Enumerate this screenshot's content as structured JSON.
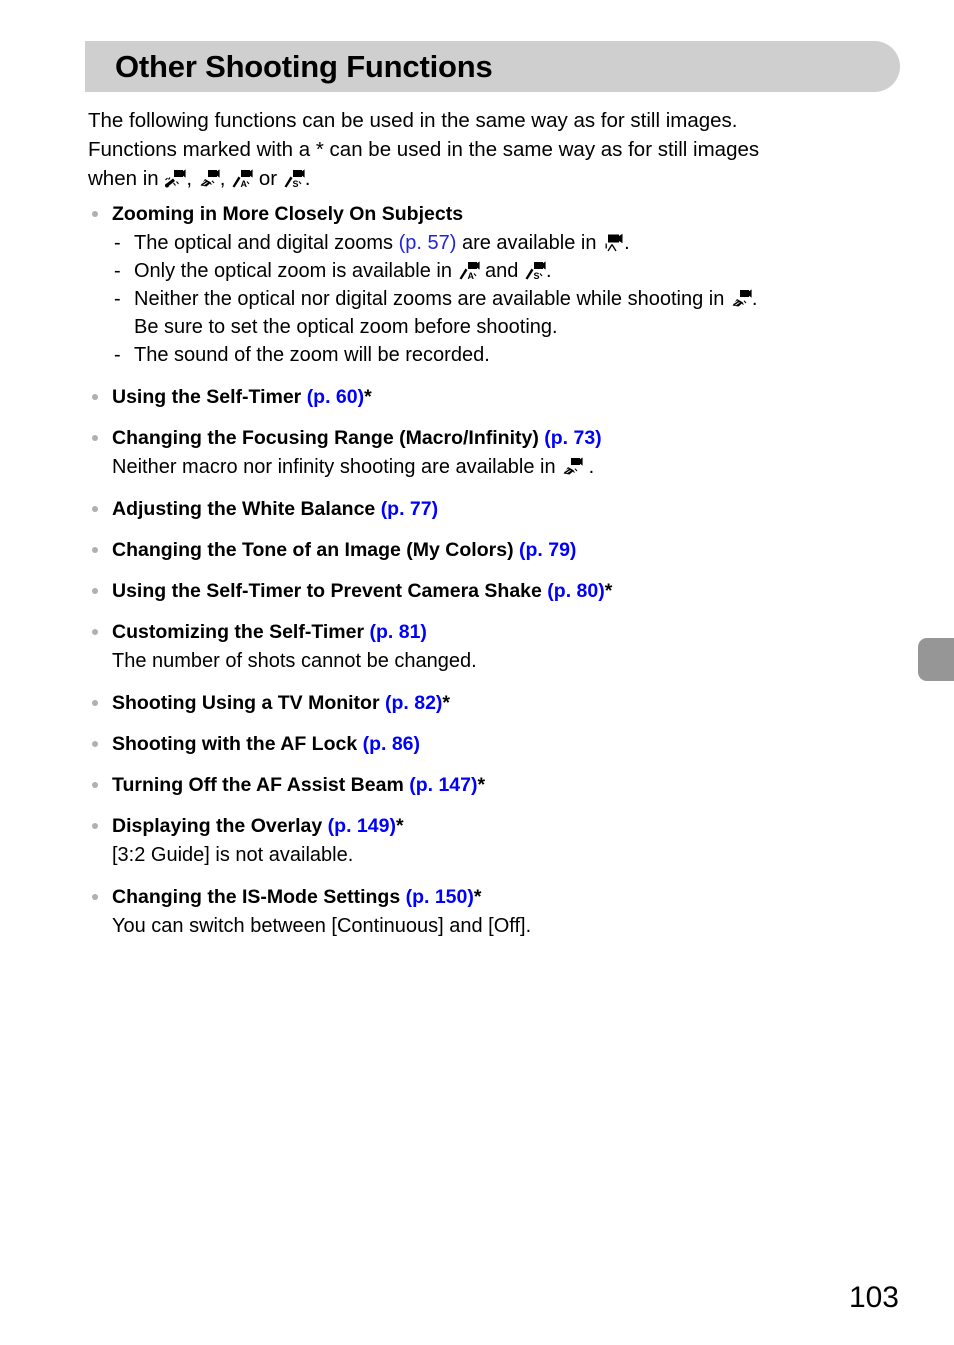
{
  "header": {
    "title": "Other Shooting Functions"
  },
  "intro": {
    "line1": "The following functions can be used in the same way as for still images.",
    "line2": "Functions marked with a * can be used in the same way as for still images",
    "line3_prefix": "when in ",
    "sep1": ", ",
    "sep2": ", ",
    "sep3": " or ",
    "line3_suffix": ".",
    "icons": [
      "movie-super-slow-motion-icon",
      "movie-miniature-effect-icon",
      "movie-color-accent-icon",
      "movie-color-swap-icon"
    ]
  },
  "items": [
    {
      "title": "Zooming in More Closely On Subjects",
      "page_ref": "",
      "star": "",
      "sub": [
        {
          "dash": "-",
          "text_before": "The optical and digital zooms ",
          "ref": "(p. 57)",
          "text_after": " are available in ",
          "icon": "movie-standard-icon",
          "text_end": ".",
          "continuation": ""
        },
        {
          "dash": "-",
          "text_before": "Only the optical zoom is available in ",
          "ref": "",
          "text_after": "",
          "icon": "movie-color-accent-icon",
          "text_mid": " and ",
          "icon2": "movie-color-swap-icon",
          "text_end": ".",
          "continuation": ""
        },
        {
          "dash": "-",
          "text_before": "Neither the optical nor digital zooms are available while shooting in ",
          "ref": "",
          "text_after": "",
          "icon": "movie-miniature-effect-icon",
          "text_end": ".",
          "continuation": "Be sure to set the optical zoom before shooting."
        },
        {
          "dash": "-",
          "text_before": "The sound of the zoom will be recorded.",
          "ref": "",
          "text_after": "",
          "icon": "",
          "text_end": "",
          "continuation": ""
        }
      ],
      "note": ""
    },
    {
      "title": "Using the Self-Timer ",
      "page_ref": "(p. 60)",
      "star": "*",
      "note": ""
    },
    {
      "title": "Changing the Focusing Range (Macro/Infinity) ",
      "page_ref": "(p. 73)",
      "star": "",
      "note_before": "Neither macro nor infinity shooting are available in ",
      "note_icon": "movie-miniature-effect-icon",
      "note_after": " ."
    },
    {
      "title": "Adjusting the White Balance ",
      "page_ref": "(p. 77)",
      "star": "",
      "note": ""
    },
    {
      "title": "Changing the Tone of an Image (My Colors) ",
      "page_ref": "(p. 79)",
      "star": "",
      "note": ""
    },
    {
      "title": "Using the Self-Timer to Prevent Camera Shake ",
      "page_ref": "(p. 80)",
      "star": "*",
      "note": ""
    },
    {
      "title": "Customizing the Self-Timer ",
      "page_ref": "(p. 81)",
      "star": "",
      "note": "The number of shots cannot be changed."
    },
    {
      "title": "Shooting Using a TV Monitor ",
      "page_ref": "(p. 82)",
      "star": "*",
      "note": ""
    },
    {
      "title": "Shooting with the AF Lock ",
      "page_ref": "(p. 86)",
      "star": "",
      "note": ""
    },
    {
      "title": "Turning Off the AF Assist Beam ",
      "page_ref": "(p. 147)",
      "star": "*",
      "note": ""
    },
    {
      "title": "Displaying the Overlay ",
      "page_ref": "(p. 149)",
      "star": "*",
      "note": "[3:2 Guide] is not available."
    },
    {
      "title": "Changing the IS-Mode Settings ",
      "page_ref": "(p. 150)",
      "star": "*",
      "note": "You can switch between [Continuous] and [Off]."
    }
  ],
  "page_number": "103",
  "colors": {
    "link": "#0000ff",
    "header_bg": "#cfcfcf",
    "thumb": "#969696",
    "bullet": "#b0b0b0"
  }
}
